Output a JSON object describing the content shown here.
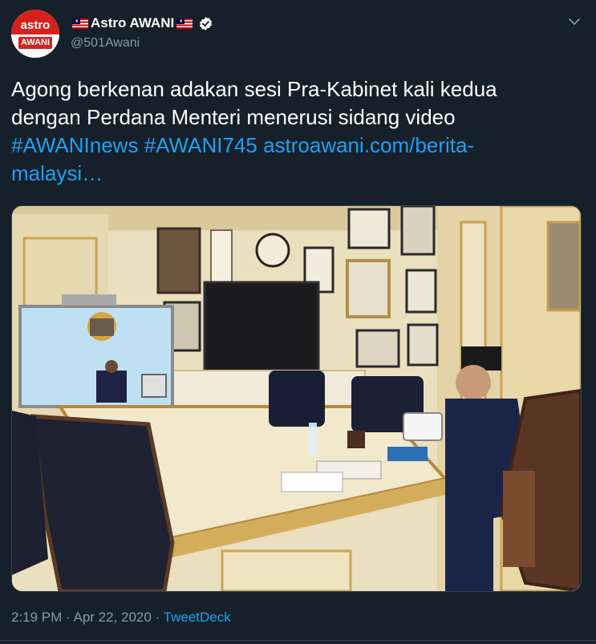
{
  "user": {
    "display_name": "Astro AWANI",
    "handle": "@501Awani",
    "avatar_top": "astro",
    "avatar_bottom": "AWANI"
  },
  "tweet": {
    "text_line1": "Agong berkenan adakan sesi Pra-Kabinet kali kedua",
    "text_line2": "dengan Perdana Menteri menerusi sidang video",
    "hashtag1": "#AWANInews",
    "hashtag2": "#AWANI745",
    "link1": "astroawani.com/berita-",
    "link2": "malaysi…"
  },
  "footer": {
    "time": "2:19 PM",
    "sep1": " · ",
    "date": "Apr 22, 2020",
    "sep2": " · ",
    "source": "TweetDeck"
  },
  "icons": {
    "verified": "verified-badge-icon",
    "chevron": "chevron-down-icon",
    "flag": "malaysia-flag-emoji"
  },
  "colors": {
    "background": "#15202b",
    "text": "#ffffff",
    "secondary": "#8899a6",
    "link": "#1da1f2",
    "divider": "#38444d"
  }
}
